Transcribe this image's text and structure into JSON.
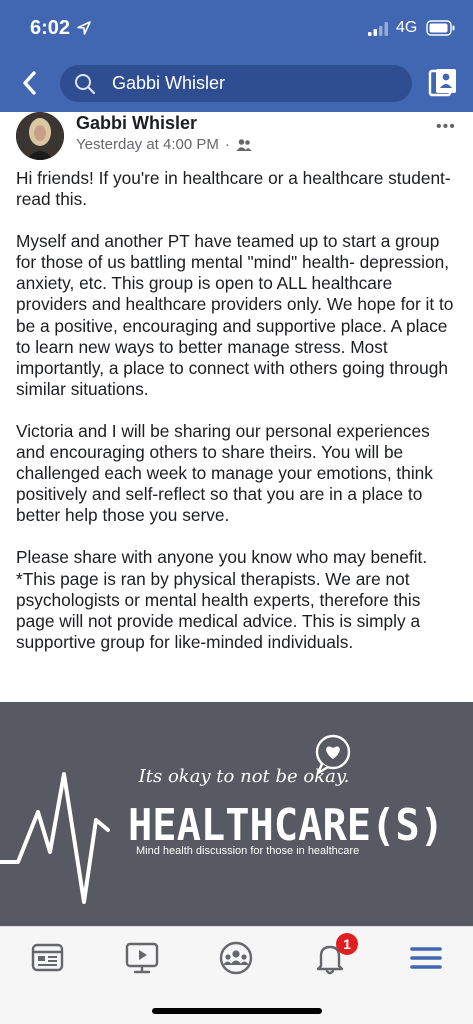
{
  "status_bar": {
    "time": "6:02",
    "network": "4G"
  },
  "search": {
    "query": "Gabbi Whisler"
  },
  "post": {
    "author": "Gabbi Whisler",
    "timestamp": "Yesterday at 4:00 PM",
    "separator": "·",
    "more_label": "•••",
    "audience_icon": "friends-icon",
    "paragraphs": [
      "Hi friends! If you're in healthcare or a healthcare student- read this.",
      "Myself and another PT have teamed up to start a group for those of us battling mental \"mind\" health- depression, anxiety, etc. This group is open to ALL healthcare providers and healthcare providers only. We hope for it to be a positive, encouraging and supportive place. A place to learn new ways to better manage stress. Most importantly, a place to connect with others going through similar situations.",
      "Victoria and I will be sharing our personal experiences and encouraging others to share theirs. You will be challenged each week to manage your emotions, think positively and self-reflect so that you are in a place to better help those you serve.",
      "Please share with anyone you know who may benefit. *This page is ran by physical therapists. We are not psychologists or mental health experts, therefore this page will not provide medical advice. This is simply a supportive group for like-minded individuals."
    ]
  },
  "image": {
    "tagline": "Its okay to not be okay.",
    "title": "HEALTHCARE(S)",
    "subtitle": "Mind health discussion for those in healthcare",
    "background": "#575a62"
  },
  "bottom_nav": {
    "items": [
      "news-feed-icon",
      "watch-icon",
      "groups-icon",
      "notifications-icon",
      "menu-icon"
    ],
    "notification_count": "1",
    "active_color": "#4267b2"
  }
}
